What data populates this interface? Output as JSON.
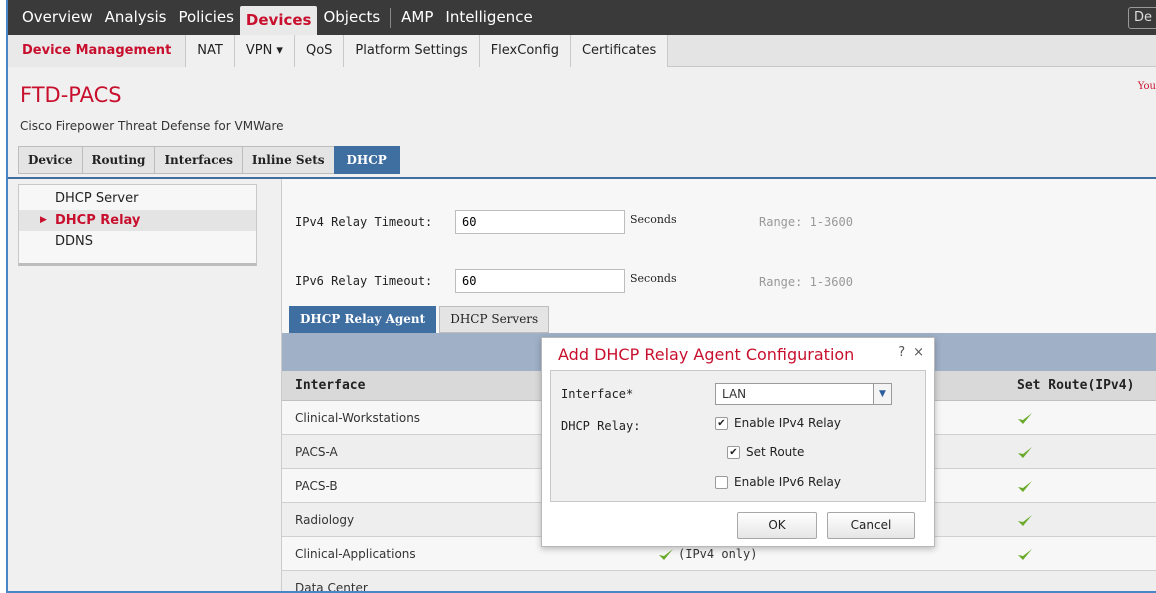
{
  "topnav": {
    "items": [
      "Overview",
      "Analysis",
      "Policies",
      "Devices",
      "Objects",
      "AMP",
      "Intelligence"
    ],
    "active": "Devices",
    "user": "De"
  },
  "subnav": {
    "items": [
      "Device Management",
      "NAT",
      "VPN ▾",
      "QoS",
      "Platform Settings",
      "FlexConfig",
      "Certificates"
    ]
  },
  "device": {
    "name": "FTD-PACS",
    "description": "Cisco Firepower Threat Defense for VMWare",
    "warning": "You"
  },
  "tabs": [
    "Device",
    "Routing",
    "Interfaces",
    "Inline Sets",
    "DHCP"
  ],
  "sidebar": [
    "DHCP Server",
    "DHCP Relay",
    "DDNS"
  ],
  "relay": {
    "ipv4_label": "IPv4 Relay Timeout:",
    "ipv4_value": "60",
    "ipv6_label": "IPv6 Relay Timeout:",
    "ipv6_value": "60",
    "unit": "Seconds",
    "range": "Range: 1-3600"
  },
  "subtabs": [
    "DHCP Relay Agent",
    "DHCP Servers"
  ],
  "table": {
    "headers": [
      "Interface",
      "Set Route(IPv4)"
    ],
    "rows": [
      {
        "interface": "Clinical-Workstations",
        "mid": ""
      },
      {
        "interface": "PACS-A",
        "mid": ""
      },
      {
        "interface": "PACS-B",
        "mid": ""
      },
      {
        "interface": "Radiology",
        "mid": ""
      },
      {
        "interface": "Clinical-Applications",
        "mid": "(IPv4 only)"
      },
      {
        "interface": "Data Center",
        "mid": ""
      }
    ]
  },
  "dialog": {
    "title": "Add DHCP Relay Agent Configuration",
    "help": "?",
    "close": "×",
    "interface_label": "Interface*",
    "interface_value": "LAN",
    "relay_label": "DHCP Relay:",
    "enable_ipv4": "Enable IPv4 Relay",
    "set_route": "Set Route",
    "enable_ipv6": "Enable IPv6 Relay",
    "ok": "OK",
    "cancel": "Cancel"
  },
  "colors": {
    "accent_red": "#c8102e",
    "tab_blue": "#3f6ea0",
    "check_green": "#6aaa2a"
  }
}
